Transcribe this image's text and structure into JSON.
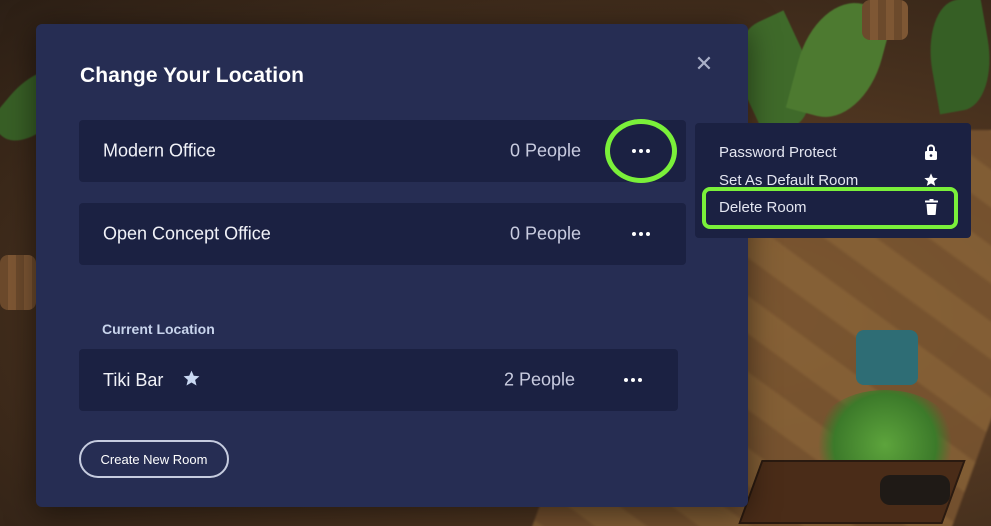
{
  "dialog": {
    "title": "Change Your Location",
    "close_icon": "close-icon"
  },
  "rooms": [
    {
      "name": "Modern Office",
      "people": "0 People"
    },
    {
      "name": "Open Concept Office",
      "people": "0 People"
    }
  ],
  "current_location": {
    "label": "Current Location",
    "room": {
      "name": "Tiki Bar",
      "people": "2 People",
      "badge_icon": "star-icon"
    }
  },
  "create_button": "Create New Room",
  "context_menu": {
    "items": [
      {
        "label": "Password Protect",
        "icon": "lock-icon"
      },
      {
        "label": "Set As Default Room",
        "icon": "star-icon"
      },
      {
        "label": "Delete Room",
        "icon": "trash-icon"
      }
    ]
  },
  "colors": {
    "modal_bg": "#262d53",
    "row_bg": "#1b2142",
    "highlight": "#7af03a"
  }
}
